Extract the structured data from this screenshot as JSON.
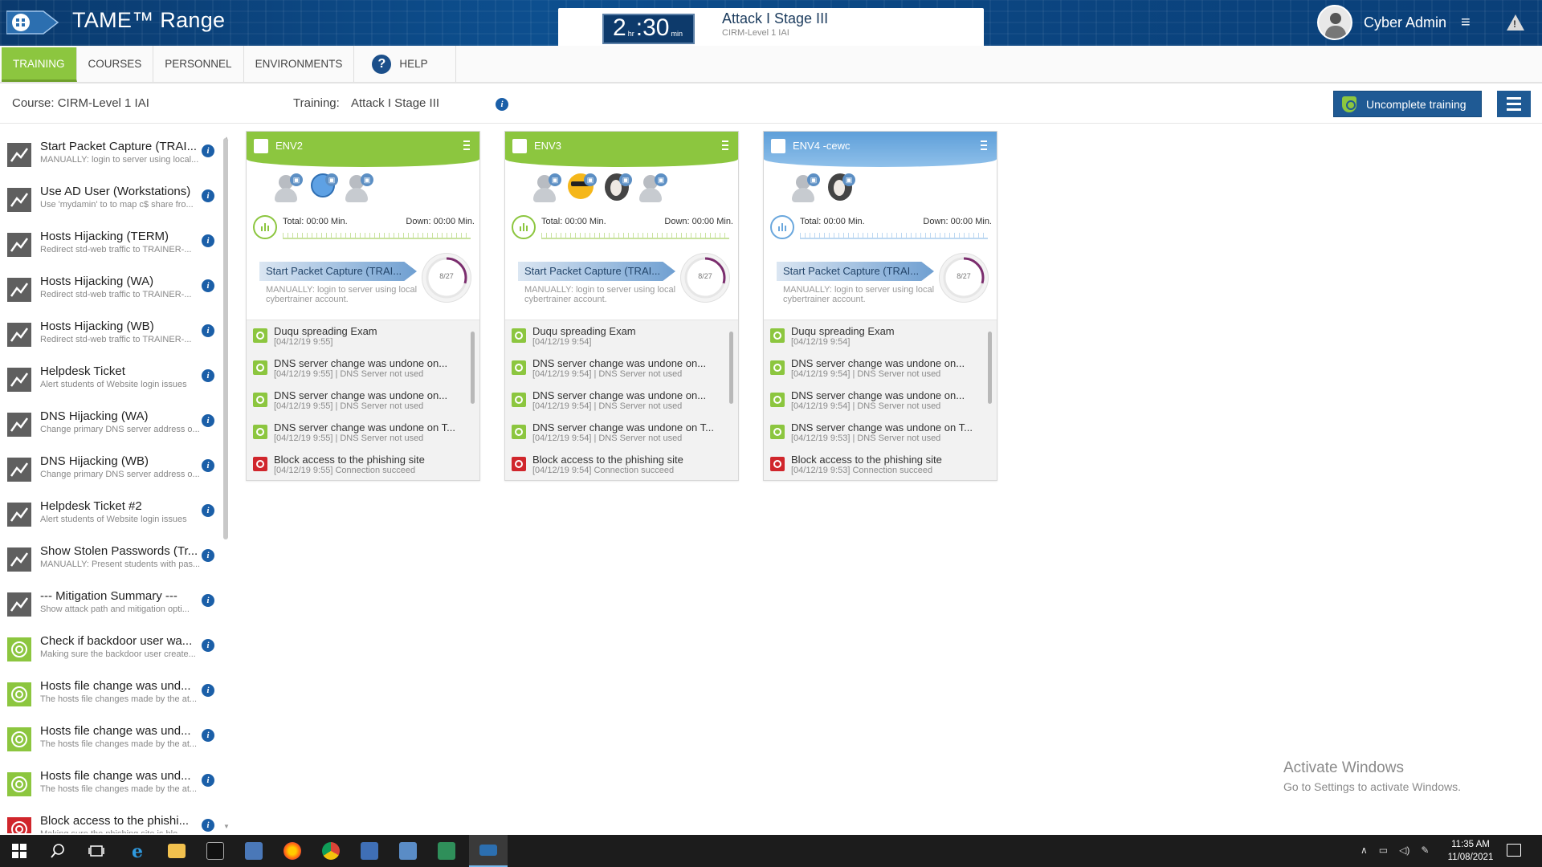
{
  "header": {
    "app_title": "TAME™ Range",
    "timer": {
      "hours": "2",
      "hours_unit": "hr",
      "minutes": "30",
      "minutes_unit": "min"
    },
    "stage_title": "Attack I Stage III",
    "stage_sub": "CIRM-Level 1 IAI",
    "user_name": "Cyber Admin"
  },
  "nav": {
    "tabs": [
      "TRAINING",
      "COURSES",
      "PERSONNEL",
      "ENVIRONMENTS"
    ],
    "help_label": "HELP",
    "active_tab": "TRAINING"
  },
  "course_row": {
    "course": "Course: CIRM-Level 1 IAI",
    "training_label": "Training:",
    "training_value": "Attack I Stage III",
    "uncomplete_label": "Uncomplete training"
  },
  "sidebar": {
    "items": [
      {
        "title": "Start Packet Capture (TRAI...",
        "sub": "MANUALLY: login to server using local...",
        "icon": "gray"
      },
      {
        "title": "Use AD User (Workstations)",
        "sub": "Use 'mydamin' to to map c$ share fro...",
        "icon": "gray"
      },
      {
        "title": "Hosts Hijacking (TERM)",
        "sub": "Redirect std-web traffic to TRAINER-...",
        "icon": "gray"
      },
      {
        "title": "Hosts Hijacking (WA)",
        "sub": "Redirect std-web traffic to TRAINER-...",
        "icon": "gray"
      },
      {
        "title": "Hosts Hijacking (WB)",
        "sub": "Redirect std-web traffic to TRAINER-...",
        "icon": "gray"
      },
      {
        "title": "Helpdesk Ticket",
        "sub": "Alert students of Website login issues",
        "icon": "gray"
      },
      {
        "title": "DNS Hijacking (WA)",
        "sub": "Change primary DNS server address o...",
        "icon": "gray"
      },
      {
        "title": "DNS Hijacking (WB)",
        "sub": "Change primary DNS server address o...",
        "icon": "gray"
      },
      {
        "title": "Helpdesk Ticket #2",
        "sub": "Alert students of Website login issues",
        "icon": "gray"
      },
      {
        "title": "Show Stolen Passwords (Tr...",
        "sub": "MANUALLY: Present students with pas...",
        "icon": "gray"
      },
      {
        "title": "--- Mitigation Summary ---",
        "sub": "Show attack path and mitigation opti...",
        "icon": "gray"
      },
      {
        "title": "Check if backdoor user wa...",
        "sub": "Making sure the backdoor user create...",
        "icon": "green"
      },
      {
        "title": "Hosts file change was und...",
        "sub": "The hosts file changes made by the at...",
        "icon": "green"
      },
      {
        "title": "Hosts file change was und...",
        "sub": "The hosts file changes made by the at...",
        "icon": "green"
      },
      {
        "title": "Hosts file change was und...",
        "sub": "The hosts file changes made by the at...",
        "icon": "green"
      },
      {
        "title": "Block access to the phishi...",
        "sub": "Making sure the phishing site is blo...",
        "icon": "red"
      }
    ]
  },
  "envs": [
    {
      "name": "ENV2",
      "color": "green",
      "total": "Total: 00:00 Min.",
      "down": "Down: 00:00 Min.",
      "task_title": "Start Packet Capture (TRAI...",
      "task_sub": "MANUALLY: login to server using local cybertrainer account.",
      "progress_label": "8/27",
      "progress": 0.296,
      "events": [
        {
          "title": "Duqu spreading Exam",
          "sub": "[04/12/19 9:55]",
          "type": "exam"
        },
        {
          "title": "DNS server change was undone on...",
          "sub": "[04/12/19 9:55] | DNS Server not used",
          "type": "ok"
        },
        {
          "title": "DNS server change was undone on...",
          "sub": "[04/12/19 9:55] | DNS Server not used",
          "type": "ok"
        },
        {
          "title": "DNS server change was undone on T...",
          "sub": "[04/12/19 9:55] | DNS Server not used",
          "type": "ok"
        },
        {
          "title": "Block access to the phishing site",
          "sub": "[04/12/19 9:55] Connection succeed",
          "type": "fail"
        }
      ]
    },
    {
      "name": "ENV3",
      "color": "green",
      "total": "Total: 00:00 Min.",
      "down": "Down: 00:00 Min.",
      "task_title": "Start Packet Capture (TRAI...",
      "task_sub": "MANUALLY: login to server using local cybertrainer account.",
      "progress_label": "8/27",
      "progress": 0.296,
      "events": [
        {
          "title": "Duqu spreading Exam",
          "sub": "[04/12/19 9:54]",
          "type": "exam"
        },
        {
          "title": "DNS server change was undone on...",
          "sub": "[04/12/19 9:54] | DNS Server not used",
          "type": "ok"
        },
        {
          "title": "DNS server change was undone on...",
          "sub": "[04/12/19 9:54] | DNS Server not used",
          "type": "ok"
        },
        {
          "title": "DNS server change was undone on T...",
          "sub": "[04/12/19 9:54] | DNS Server not used",
          "type": "ok"
        },
        {
          "title": "Block access to the phishing site",
          "sub": "[04/12/19 9:54] Connection succeed",
          "type": "fail"
        }
      ]
    },
    {
      "name": "ENV4 -cewc",
      "color": "blue",
      "total": "Total: 00:00 Min.",
      "down": "Down: 00:00 Min.",
      "task_title": "Start Packet Capture (TRAI...",
      "task_sub": "MANUALLY: login to server using local cybertrainer account.",
      "progress_label": "8/27",
      "progress": 0.296,
      "events": [
        {
          "title": "Duqu spreading Exam",
          "sub": "[04/12/19 9:54]",
          "type": "exam"
        },
        {
          "title": "DNS server change was undone on...",
          "sub": "[04/12/19 9:54] | DNS Server not used",
          "type": "ok"
        },
        {
          "title": "DNS server change was undone on...",
          "sub": "[04/12/19 9:54] | DNS Server not used",
          "type": "ok"
        },
        {
          "title": "DNS server change was undone on T...",
          "sub": "[04/12/19 9:53] | DNS Server not used",
          "type": "ok"
        },
        {
          "title": "Block access to the phishing site",
          "sub": "[04/12/19 9:53] Connection succeed",
          "type": "fail"
        }
      ]
    }
  ],
  "watermark": {
    "line1": "Activate Windows",
    "line2": "Go to Settings to activate Windows."
  },
  "taskbar": {
    "time": "11:35 AM",
    "date": "11/08/2021"
  },
  "colors": {
    "accent_green": "#8cc63f",
    "header_blue": "#0d4f8f",
    "button_blue": "#1f5a94",
    "fail_red": "#d0262c"
  }
}
